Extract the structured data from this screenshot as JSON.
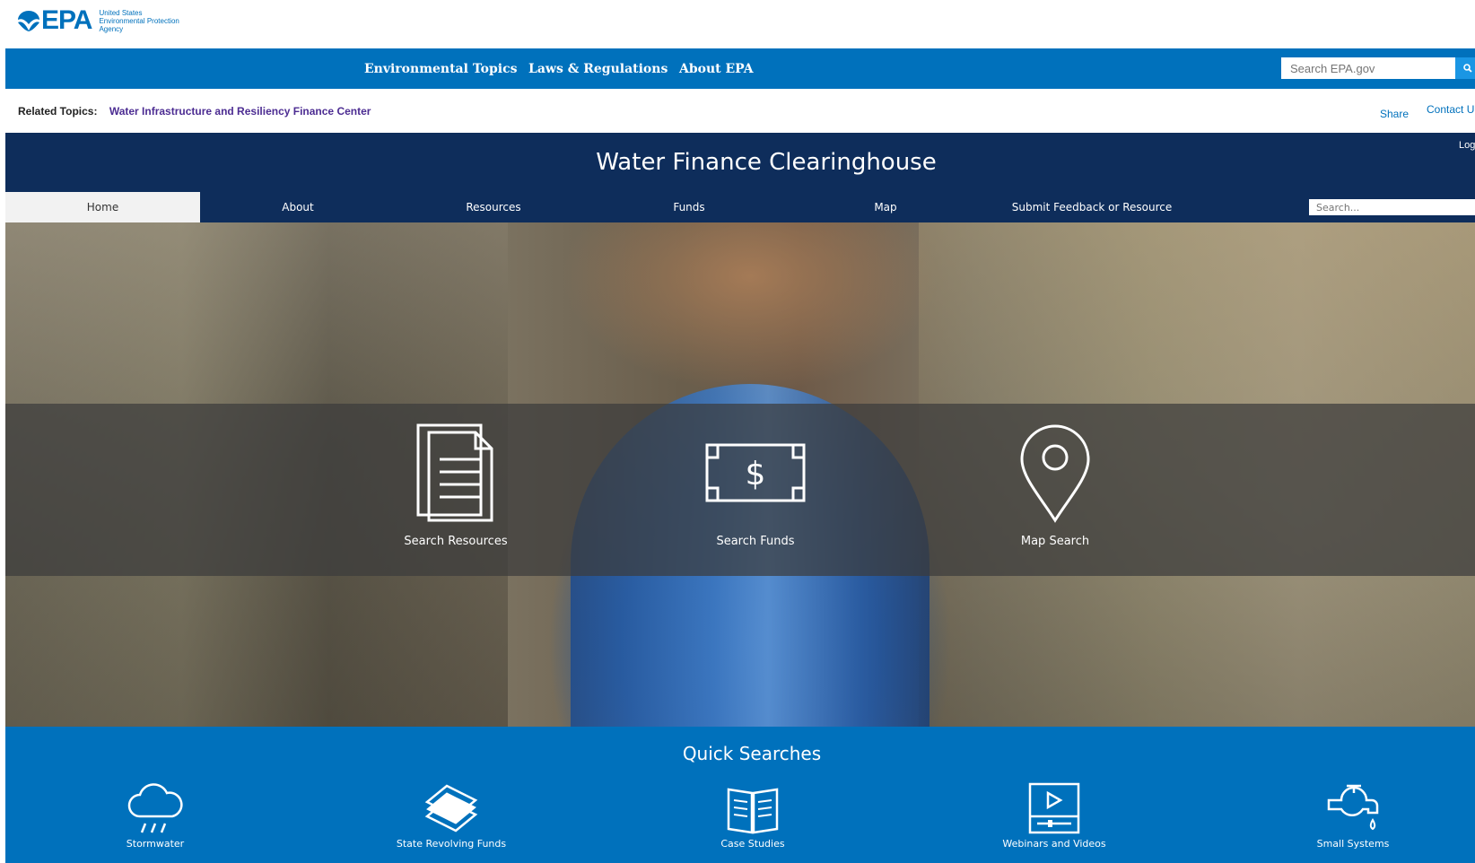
{
  "header": {
    "logo_text": "EPA",
    "agency_lines": [
      "United States",
      "Environmental Protection",
      "Agency"
    ],
    "nav": [
      "Environmental Topics",
      "Laws & Regulations",
      "About EPA"
    ],
    "search_placeholder": "Search EPA.gov",
    "search_button_icon": "search-icon"
  },
  "related": {
    "label": "Related Topics:",
    "link": "Water Infrastructure and Resiliency Finance Center",
    "share": "Share",
    "contact": "Contact U"
  },
  "app": {
    "title": "Water Finance Clearinghouse",
    "login": "Log",
    "tabs": [
      "Home",
      "About",
      "Resources",
      "Funds",
      "Map",
      "Submit Feedback or Resource"
    ],
    "active_tab": "Home",
    "search_placeholder": "Search..."
  },
  "hero": {
    "actions": [
      {
        "label": "Search Resources",
        "icon": "document-icon"
      },
      {
        "label": "Search Funds",
        "icon": "dollar-bill-icon"
      },
      {
        "label": "Map Search",
        "icon": "map-pin-icon"
      }
    ]
  },
  "quick": {
    "title": "Quick Searches",
    "items": [
      {
        "label": "Stormwater",
        "icon": "rain-cloud-icon"
      },
      {
        "label": "State Revolving Funds",
        "icon": "money-stack-icon"
      },
      {
        "label": "Case Studies",
        "icon": "book-icon"
      },
      {
        "label": "Webinars and Videos",
        "icon": "video-player-icon"
      },
      {
        "label": "Small Systems",
        "icon": "faucet-icon"
      }
    ]
  },
  "colors": {
    "epa_blue": "#0071bc",
    "navy": "#0e2d5b",
    "link_purple": "#4c2c92"
  }
}
